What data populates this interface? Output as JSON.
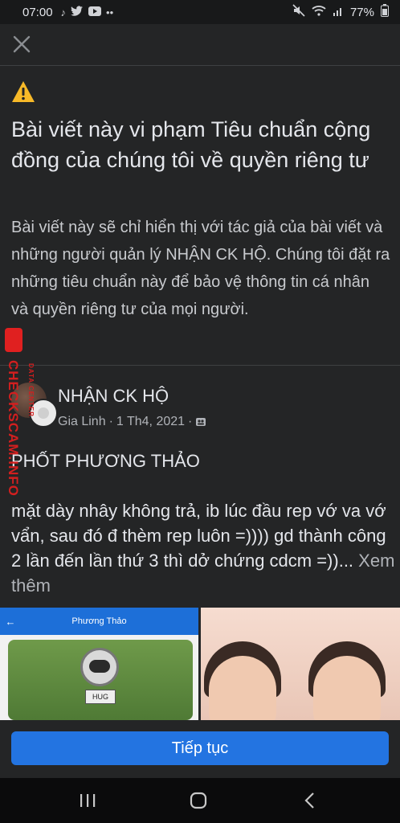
{
  "status_bar": {
    "time": "07:00",
    "battery": "77%"
  },
  "dialog": {
    "title": "Bài viết này vi phạm Tiêu chuẩn cộng đồng của chúng tôi về quyền riêng tư",
    "description": "Bài viết này sẽ chỉ hiển thị với tác giả của bài viết và những người quản lý NHẬN CK HỘ. Chúng tôi đặt ra những tiêu chuẩn này để bảo vệ thông tin cá nhân và quyền riêng tư của mọi người."
  },
  "post": {
    "group_name": "NHẬN CK HỘ",
    "author": "Gia Linh",
    "date": "1 Th4, 2021",
    "text": "PHỐT PHƯƠNG THẢO\n\nmặt dày nhây không trả, ib lúc đầu rep vớ va vớ vẩn, sau đó đ thèm rep luôn =)))) gd thành công 2 lần đến lần thứ 3 thì dở chứng cdcm =))...",
    "see_more": "Xem thêm",
    "photo_left": {
      "title": "Phương Thảo",
      "badge": "HUG"
    }
  },
  "continue_button": "Tiếp tục",
  "watermark": {
    "text": "CHECKSCAM.INFO",
    "sub": "DATA CENTER"
  },
  "colors": {
    "background": "#242526",
    "accent": "#2374e1",
    "warning": "#f7b928"
  }
}
